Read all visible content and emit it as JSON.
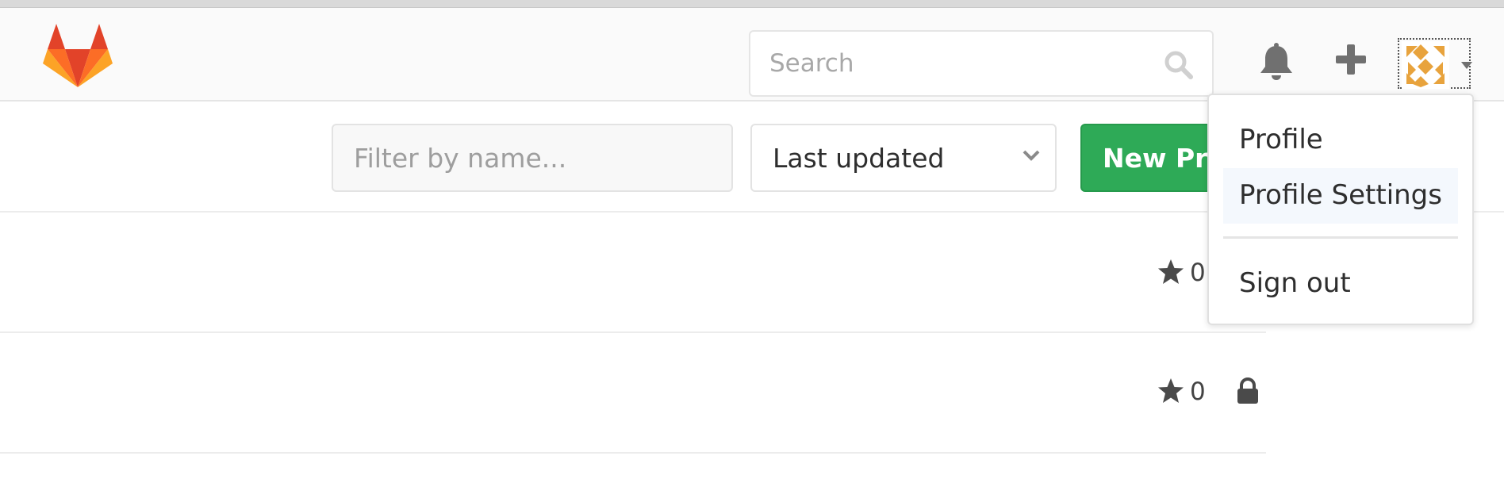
{
  "header": {
    "search_placeholder": "Search"
  },
  "toolbar": {
    "filter_placeholder": "Filter by name...",
    "sort_selected": "Last updated",
    "new_project_label": "New Project"
  },
  "projects": [
    {
      "stars": "0",
      "private": false
    },
    {
      "stars": "0",
      "private": true
    }
  ],
  "user_menu": {
    "items": [
      "Profile",
      "Profile Settings",
      "Sign out"
    ]
  },
  "colors": {
    "accent_green": "#2eaa57",
    "logo_orange": "#e24329",
    "logo_light": "#fca326"
  }
}
